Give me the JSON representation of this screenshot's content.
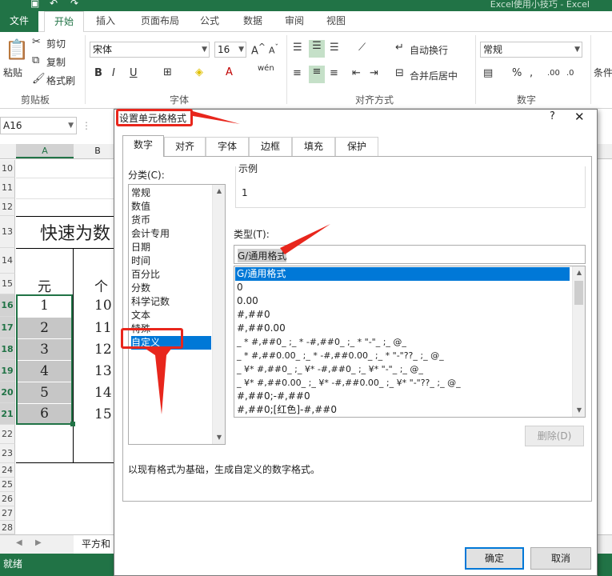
{
  "window": {
    "title": "Excel使用小技巧 - Excel"
  },
  "tabs": [
    "文件",
    "开始",
    "插入",
    "页面布局",
    "公式",
    "数据",
    "审阅",
    "视图"
  ],
  "ribbon": {
    "paste": "粘贴",
    "cut": "剪切",
    "copy": "复制",
    "format_painter": "格式刷",
    "clipboard_group": "剪贴板",
    "font_name": "宋体",
    "font_size": "16",
    "font_group": "字体",
    "wrap_text": "自动换行",
    "merge_center": "合并后居中",
    "align_group": "对齐方式",
    "number_format": "常规",
    "number_group": "数字",
    "conditional": "条件"
  },
  "namebox": "A16",
  "sheet": {
    "columns": [
      "A",
      "B"
    ],
    "rows": [
      "10",
      "11",
      "12",
      "13",
      "14",
      "15",
      "16",
      "17",
      "18",
      "19",
      "20",
      "21",
      "22",
      "23",
      "24",
      "25",
      "26",
      "27",
      "28"
    ],
    "title_cell": "快速为数",
    "header_a": "元",
    "header_b": "个",
    "col_a": [
      "1",
      "2",
      "3",
      "4",
      "5",
      "6"
    ],
    "col_b": [
      "10",
      "11",
      "12",
      "13",
      "14",
      "15"
    ],
    "sheet_tab": "平方和"
  },
  "status": "就绪",
  "dialog": {
    "title": "设置单元格格式",
    "help": "?",
    "tabs": [
      "数字",
      "对齐",
      "字体",
      "边框",
      "填充",
      "保护"
    ],
    "category_label": "分类(C):",
    "categories": [
      "常规",
      "数值",
      "货币",
      "会计专用",
      "日期",
      "时间",
      "百分比",
      "分数",
      "科学记数",
      "文本",
      "特殊",
      "自定义"
    ],
    "sample_label": "示例",
    "sample_value": "1",
    "type_label": "类型(T):",
    "type_value": "G/通用格式",
    "formats": [
      "G/通用格式",
      "0",
      "0.00",
      "#,##0",
      "#,##0.00",
      "_ * #,##0_ ;_ * -#,##0_ ;_ * \"-\"_ ;_ @_",
      "_ * #,##0.00_ ;_ * -#,##0.00_ ;_ * \"-\"??_ ;_ @_",
      "_ ¥* #,##0_ ;_ ¥* -#,##0_ ;_ ¥* \"-\"_ ;_ @_",
      "_ ¥* #,##0.00_ ;_ ¥* -#,##0.00_ ;_ ¥* \"-\"??_ ;_ @_",
      "#,##0;-#,##0",
      "#,##0;[红色]-#,##0"
    ],
    "delete_button": "删除(D)",
    "description": "以现有格式为基础，生成自定义的数字格式。",
    "ok_button": "确定",
    "cancel_button": "取消"
  },
  "colors": {
    "excel_green": "#217346",
    "selection_blue": "#0078d7",
    "annotation_red": "#e8261c"
  }
}
